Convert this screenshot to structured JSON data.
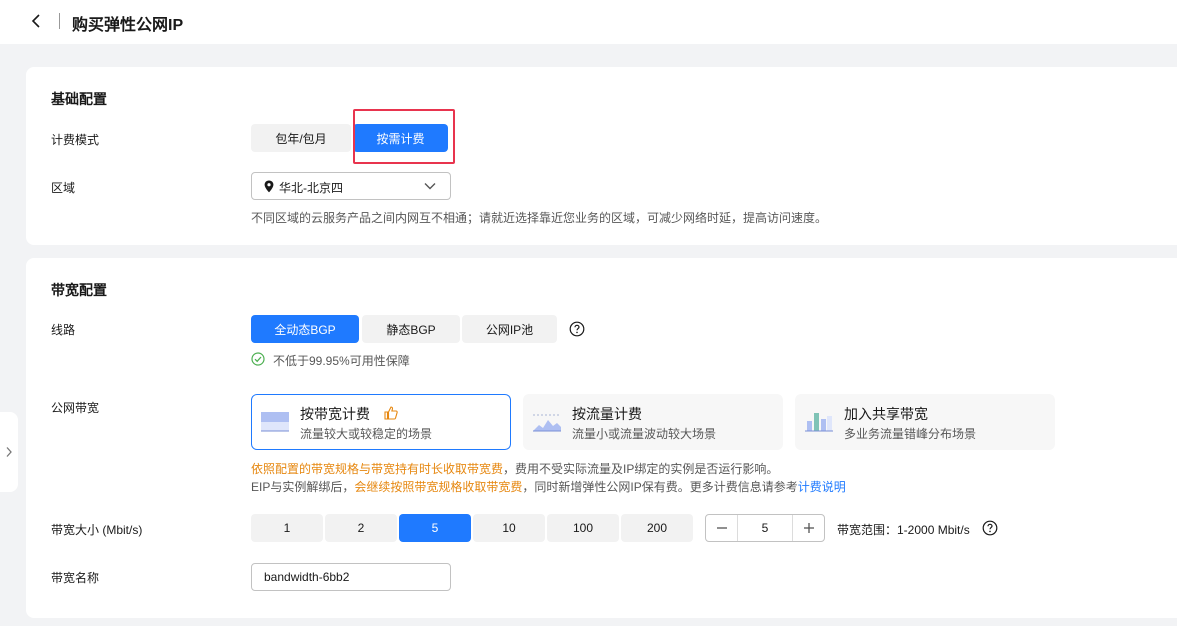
{
  "header": {
    "title": "购买弹性公网IP"
  },
  "basic": {
    "section_title": "基础配置",
    "billing": {
      "label": "计费模式",
      "options": [
        "包年/包月",
        "按需计费"
      ],
      "selected": "按需计费"
    },
    "region": {
      "label": "区域",
      "value": "华北-北京四",
      "hint": "不同区域的云服务产品之间内网互不相通；请就近选择靠近您业务的区域，可减少网络时延，提高访问速度。"
    }
  },
  "bandwidth": {
    "section_title": "带宽配置",
    "line": {
      "label": "线路",
      "options": [
        "全动态BGP",
        "静态BGP",
        "公网IP池"
      ],
      "selected": "全动态BGP",
      "guarantee": "不低于99.95%可用性保障"
    },
    "public": {
      "label": "公网带宽",
      "options": [
        {
          "title": "按带宽计费",
          "subtitle": "流量较大或较稳定的场景"
        },
        {
          "title": "按流量计费",
          "subtitle": "流量小或流量波动较大场景"
        },
        {
          "title": "加入共享带宽",
          "subtitle": "多业务流量错峰分布场景"
        }
      ],
      "selected": "按带宽计费",
      "note1_warn": "依照配置的带宽规格与带宽持有时长收取带宽费",
      "note1_rest": "，费用不受实际流量及IP绑定的实例是否运行影响。",
      "note2_a": "EIP与实例解绑后，",
      "note2_warn": "会继续按照带宽规格收取带宽费",
      "note2_b": "，同时新增弹性公网IP保有费。更多计费信息请参考",
      "note2_link": "计费说明"
    },
    "size": {
      "label": "带宽大小 (Mbit/s)",
      "options": [
        "1",
        "2",
        "5",
        "10",
        "100",
        "200"
      ],
      "selected": "5",
      "stepper_value": "5",
      "range": "带宽范围：1-2000 Mbit/s"
    },
    "name": {
      "label": "带宽名称",
      "value": "bandwidth-6bb2"
    }
  },
  "colors": {
    "accent": "#1f7aff",
    "warning": "#e6870f",
    "success": "#4caf50",
    "highlight": "#e8344e"
  }
}
